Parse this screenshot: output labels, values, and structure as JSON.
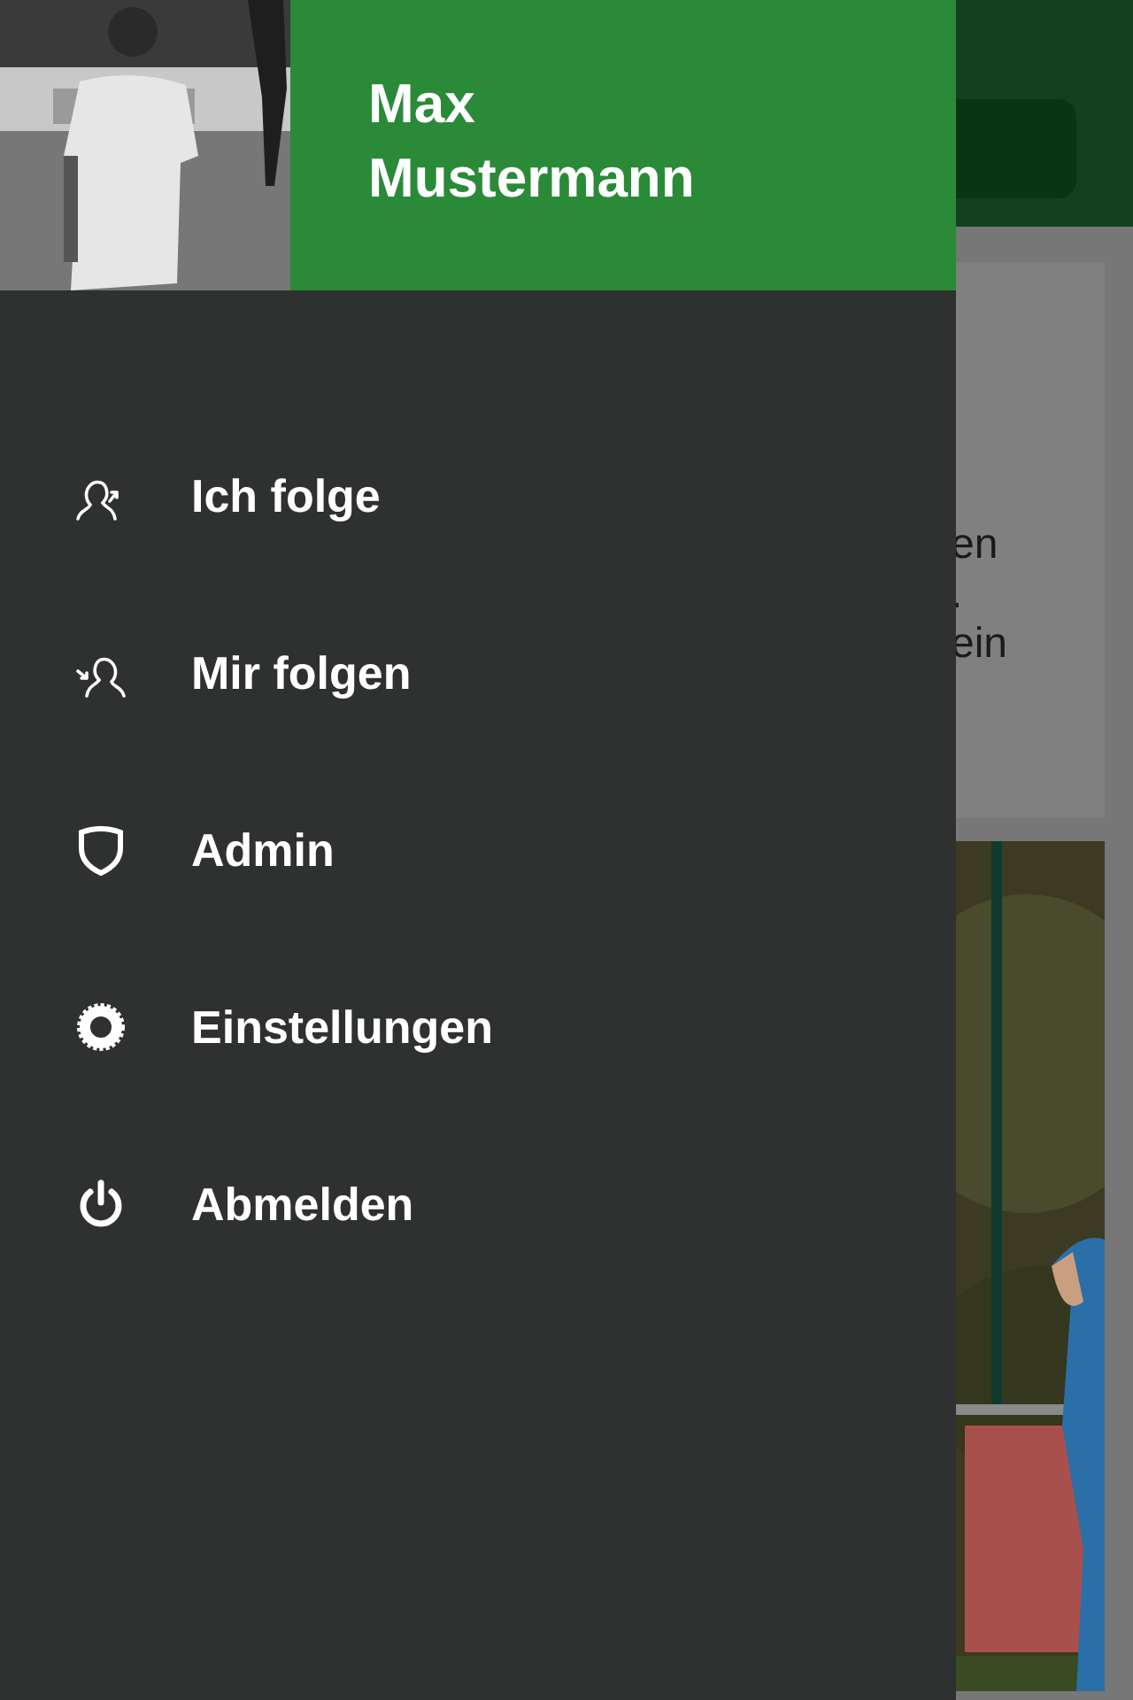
{
  "user": {
    "name": "Max Mustermann"
  },
  "menu": [
    {
      "label": "Ich folge",
      "kind": "following"
    },
    {
      "label": "Mir folgen",
      "kind": "followers"
    },
    {
      "label": "Admin",
      "kind": "admin"
    },
    {
      "label": "Einstellungen",
      "kind": "settings"
    },
    {
      "label": "Abmelden",
      "kind": "logout"
    }
  ],
  "background": {
    "card_lines": [
      "en",
      ".",
      "ein"
    ]
  }
}
